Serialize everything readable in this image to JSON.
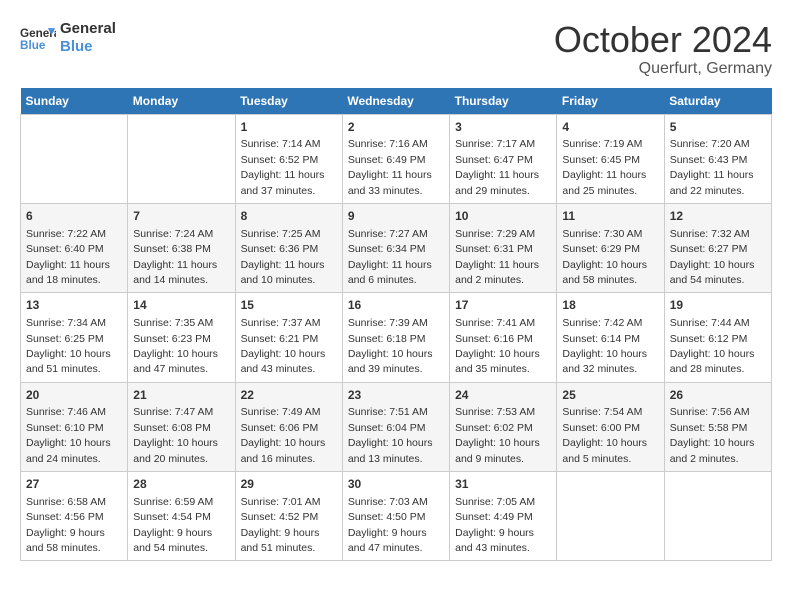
{
  "header": {
    "logo_line1": "General",
    "logo_line2": "Blue",
    "month": "October 2024",
    "location": "Querfurt, Germany"
  },
  "weekdays": [
    "Sunday",
    "Monday",
    "Tuesday",
    "Wednesday",
    "Thursday",
    "Friday",
    "Saturday"
  ],
  "weeks": [
    [
      {
        "day": "",
        "info": ""
      },
      {
        "day": "",
        "info": ""
      },
      {
        "day": "1",
        "info": "Sunrise: 7:14 AM\nSunset: 6:52 PM\nDaylight: 11 hours and 37 minutes."
      },
      {
        "day": "2",
        "info": "Sunrise: 7:16 AM\nSunset: 6:49 PM\nDaylight: 11 hours and 33 minutes."
      },
      {
        "day": "3",
        "info": "Sunrise: 7:17 AM\nSunset: 6:47 PM\nDaylight: 11 hours and 29 minutes."
      },
      {
        "day": "4",
        "info": "Sunrise: 7:19 AM\nSunset: 6:45 PM\nDaylight: 11 hours and 25 minutes."
      },
      {
        "day": "5",
        "info": "Sunrise: 7:20 AM\nSunset: 6:43 PM\nDaylight: 11 hours and 22 minutes."
      }
    ],
    [
      {
        "day": "6",
        "info": "Sunrise: 7:22 AM\nSunset: 6:40 PM\nDaylight: 11 hours and 18 minutes."
      },
      {
        "day": "7",
        "info": "Sunrise: 7:24 AM\nSunset: 6:38 PM\nDaylight: 11 hours and 14 minutes."
      },
      {
        "day": "8",
        "info": "Sunrise: 7:25 AM\nSunset: 6:36 PM\nDaylight: 11 hours and 10 minutes."
      },
      {
        "day": "9",
        "info": "Sunrise: 7:27 AM\nSunset: 6:34 PM\nDaylight: 11 hours and 6 minutes."
      },
      {
        "day": "10",
        "info": "Sunrise: 7:29 AM\nSunset: 6:31 PM\nDaylight: 11 hours and 2 minutes."
      },
      {
        "day": "11",
        "info": "Sunrise: 7:30 AM\nSunset: 6:29 PM\nDaylight: 10 hours and 58 minutes."
      },
      {
        "day": "12",
        "info": "Sunrise: 7:32 AM\nSunset: 6:27 PM\nDaylight: 10 hours and 54 minutes."
      }
    ],
    [
      {
        "day": "13",
        "info": "Sunrise: 7:34 AM\nSunset: 6:25 PM\nDaylight: 10 hours and 51 minutes."
      },
      {
        "day": "14",
        "info": "Sunrise: 7:35 AM\nSunset: 6:23 PM\nDaylight: 10 hours and 47 minutes."
      },
      {
        "day": "15",
        "info": "Sunrise: 7:37 AM\nSunset: 6:21 PM\nDaylight: 10 hours and 43 minutes."
      },
      {
        "day": "16",
        "info": "Sunrise: 7:39 AM\nSunset: 6:18 PM\nDaylight: 10 hours and 39 minutes."
      },
      {
        "day": "17",
        "info": "Sunrise: 7:41 AM\nSunset: 6:16 PM\nDaylight: 10 hours and 35 minutes."
      },
      {
        "day": "18",
        "info": "Sunrise: 7:42 AM\nSunset: 6:14 PM\nDaylight: 10 hours and 32 minutes."
      },
      {
        "day": "19",
        "info": "Sunrise: 7:44 AM\nSunset: 6:12 PM\nDaylight: 10 hours and 28 minutes."
      }
    ],
    [
      {
        "day": "20",
        "info": "Sunrise: 7:46 AM\nSunset: 6:10 PM\nDaylight: 10 hours and 24 minutes."
      },
      {
        "day": "21",
        "info": "Sunrise: 7:47 AM\nSunset: 6:08 PM\nDaylight: 10 hours and 20 minutes."
      },
      {
        "day": "22",
        "info": "Sunrise: 7:49 AM\nSunset: 6:06 PM\nDaylight: 10 hours and 16 minutes."
      },
      {
        "day": "23",
        "info": "Sunrise: 7:51 AM\nSunset: 6:04 PM\nDaylight: 10 hours and 13 minutes."
      },
      {
        "day": "24",
        "info": "Sunrise: 7:53 AM\nSunset: 6:02 PM\nDaylight: 10 hours and 9 minutes."
      },
      {
        "day": "25",
        "info": "Sunrise: 7:54 AM\nSunset: 6:00 PM\nDaylight: 10 hours and 5 minutes."
      },
      {
        "day": "26",
        "info": "Sunrise: 7:56 AM\nSunset: 5:58 PM\nDaylight: 10 hours and 2 minutes."
      }
    ],
    [
      {
        "day": "27",
        "info": "Sunrise: 6:58 AM\nSunset: 4:56 PM\nDaylight: 9 hours and 58 minutes."
      },
      {
        "day": "28",
        "info": "Sunrise: 6:59 AM\nSunset: 4:54 PM\nDaylight: 9 hours and 54 minutes."
      },
      {
        "day": "29",
        "info": "Sunrise: 7:01 AM\nSunset: 4:52 PM\nDaylight: 9 hours and 51 minutes."
      },
      {
        "day": "30",
        "info": "Sunrise: 7:03 AM\nSunset: 4:50 PM\nDaylight: 9 hours and 47 minutes."
      },
      {
        "day": "31",
        "info": "Sunrise: 7:05 AM\nSunset: 4:49 PM\nDaylight: 9 hours and 43 minutes."
      },
      {
        "day": "",
        "info": ""
      },
      {
        "day": "",
        "info": ""
      }
    ]
  ]
}
